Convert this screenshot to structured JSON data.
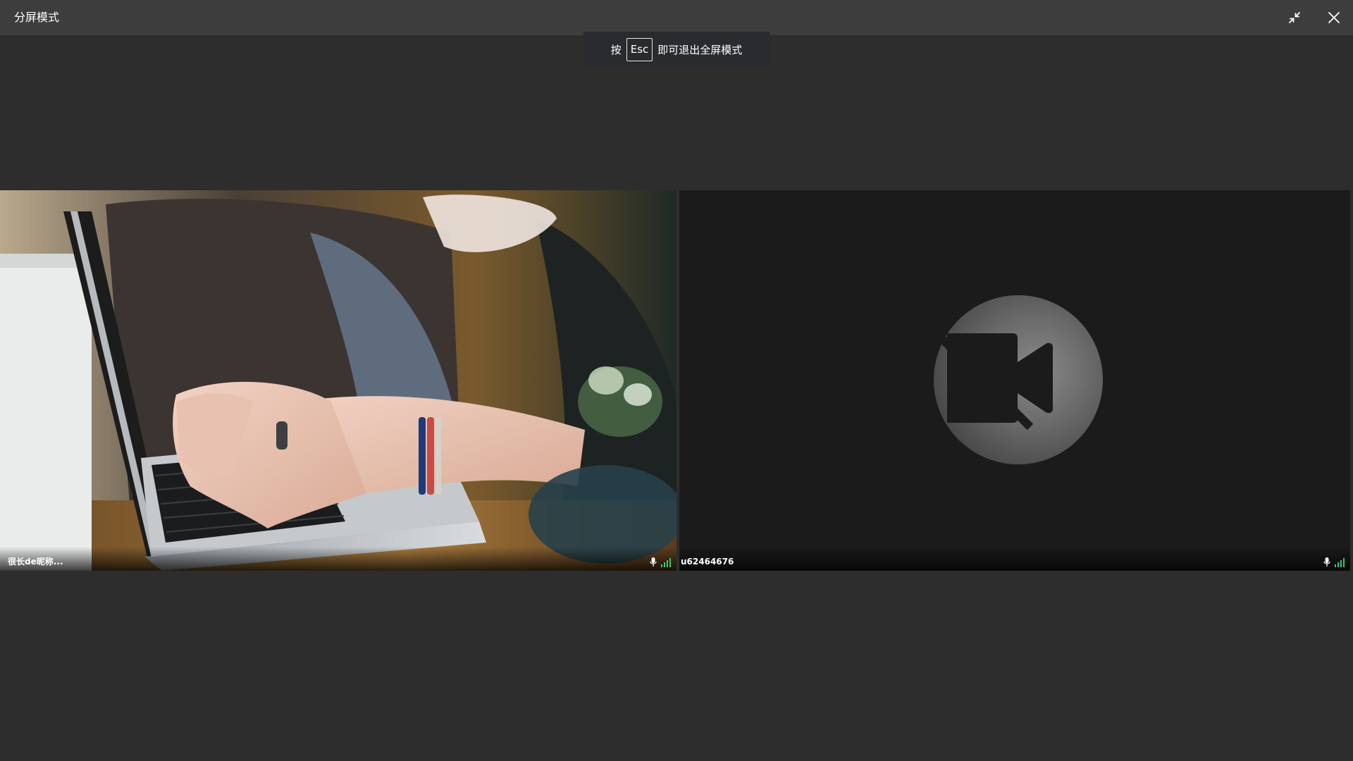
{
  "window": {
    "title": "分屏模式"
  },
  "hint": {
    "prefix": "按",
    "key": "Esc",
    "suffix": "即可退出全屏模式"
  },
  "tiles": [
    {
      "name": "很长de昵称...",
      "video": "on",
      "icons": [
        "microphone-icon",
        "signal-strength-icon"
      ]
    },
    {
      "name": "u62464676",
      "video": "off",
      "icons": [
        "microphone-icon",
        "signal-strength-icon"
      ]
    }
  ],
  "colors": {
    "titlebar": "#3d3d3d",
    "background": "#2d2d2d",
    "signal": "#2ecc71",
    "video_off_tile": "#1b1b1b"
  }
}
